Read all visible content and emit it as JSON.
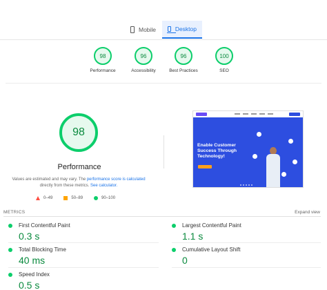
{
  "tabs": [
    {
      "label": "Mobile",
      "active": false,
      "icon": "phone-icon"
    },
    {
      "label": "Desktop",
      "active": true,
      "icon": "monitor-icon"
    }
  ],
  "summary_scores": [
    {
      "score": "98",
      "label": "Performance"
    },
    {
      "score": "96",
      "label": "Accessibility"
    },
    {
      "score": "96",
      "label": "Best Practices"
    },
    {
      "score": "100",
      "label": "SEO"
    }
  ],
  "performance": {
    "score": "98",
    "title": "Performance",
    "note_prefix": "Values are estimated and may vary. The ",
    "note_link1": "performance score is calculated",
    "note_middle": " directly from these metrics. ",
    "note_link2": "See calculator."
  },
  "legend": [
    {
      "range": "0–49",
      "color": "#ff4e42",
      "shape": "triangle"
    },
    {
      "range": "50–89",
      "color": "#ffa400",
      "shape": "square"
    },
    {
      "range": "90–100",
      "color": "#0cce6b",
      "shape": "circle"
    }
  ],
  "screenshot": {
    "headline": "Enable Customer Success Through Technology!"
  },
  "metrics": {
    "heading": "METRICS",
    "expand_label": "Expand view",
    "items": [
      {
        "label": "First Contentful Paint",
        "value": "0.3 s"
      },
      {
        "label": "Largest Contentful Paint",
        "value": "1.1 s"
      },
      {
        "label": "Total Blocking Time",
        "value": "40 ms"
      },
      {
        "label": "Cumulative Layout Shift",
        "value": "0"
      },
      {
        "label": "Speed Index",
        "value": "0.5 s"
      }
    ]
  },
  "colors": {
    "good": "#0cce6b",
    "accent": "#1a73e8"
  }
}
